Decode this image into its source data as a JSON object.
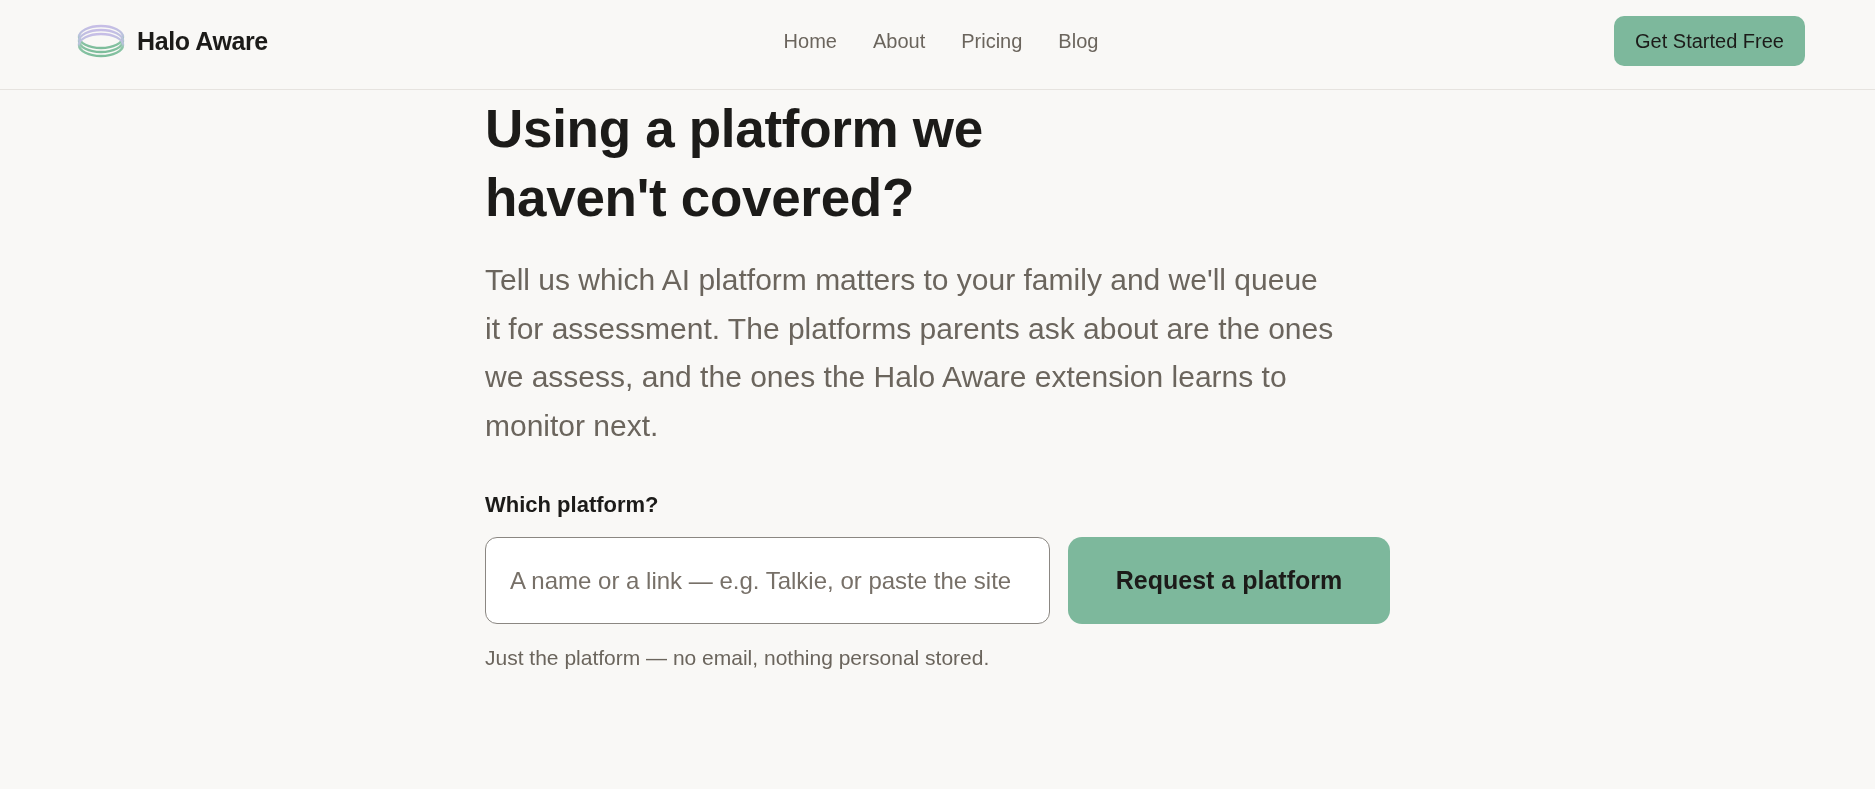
{
  "header": {
    "brand": "Halo Aware",
    "nav": [
      {
        "label": "Home"
      },
      {
        "label": "About"
      },
      {
        "label": "Pricing"
      },
      {
        "label": "Blog"
      }
    ],
    "cta": "Get Started Free"
  },
  "hero": {
    "heading": "Using a platform we haven't covered?",
    "intro": "Tell us which AI platform matters to your family and we'll queue it for assessment. The platforms parents ask about are the ones we assess, and the ones the Halo Aware extension learns to monitor next."
  },
  "request_form": {
    "label": "Which platform?",
    "input": {
      "placeholder": "A name or a link — e.g. Talkie, or paste the site"
    },
    "submit": "Request a platform",
    "note": "Just the platform — no email, nothing personal stored."
  }
}
